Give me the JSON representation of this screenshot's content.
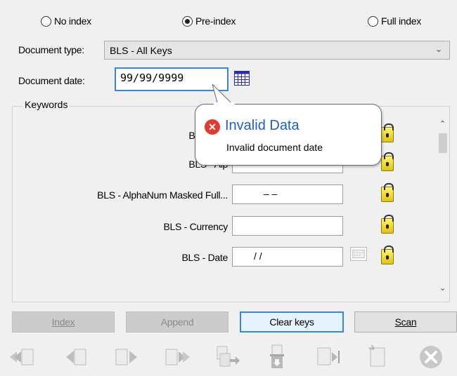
{
  "index_mode": {
    "options": [
      {
        "label": "No index",
        "checked": false
      },
      {
        "label": "Pre-index",
        "checked": true
      },
      {
        "label": "Full index",
        "checked": false
      }
    ]
  },
  "document_type": {
    "label": "Document type:",
    "value": "BLS - All Keys"
  },
  "document_date": {
    "label": "Document date:",
    "value": "99/99/9999"
  },
  "keywords": {
    "title": "Keywords",
    "rows": [
      {
        "label": "BLS - Alp",
        "value": ""
      },
      {
        "label": "BLS - Alp",
        "value": ""
      },
      {
        "label": "BLS - AlphaNum Masked Full...",
        "mask": "– –"
      },
      {
        "label": "BLS - Currency",
        "value": ""
      },
      {
        "label": "BLS - Date",
        "mask": "/ /"
      }
    ]
  },
  "tooltip": {
    "title": "Invalid Data",
    "message": "Invalid document date",
    "icon": "error-icon"
  },
  "buttons": {
    "index": "Index",
    "append": "Append",
    "clear_keys": "Clear keys",
    "scan": "Scan"
  },
  "toolbar_icons": [
    "first-document-icon",
    "previous-document-icon",
    "next-document-icon",
    "last-document-icon",
    "move-document-icon",
    "delete-document-icon",
    "insert-page-icon",
    "new-page-icon",
    "cancel-icon"
  ],
  "colors": {
    "accent": "#3a86d4",
    "error": "#e23a2e",
    "lock": "#f0d31b",
    "tooltip_title": "#1f5fbf"
  }
}
